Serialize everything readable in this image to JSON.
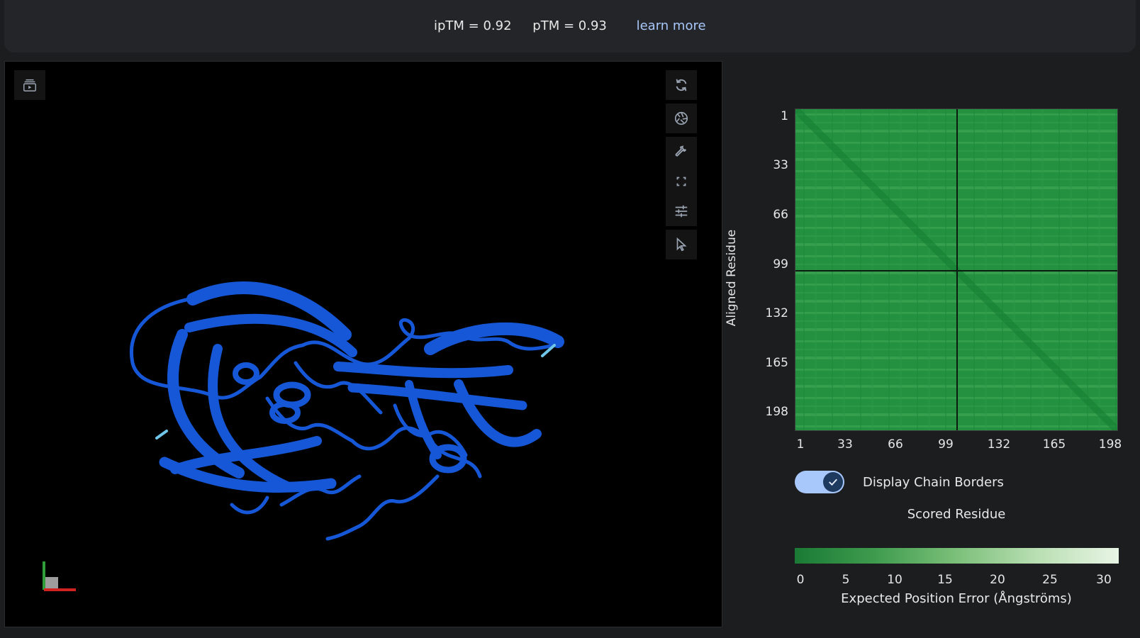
{
  "header": {
    "iptm": "ipTM = 0.92",
    "ptm": "pTM = 0.93",
    "learn_more": "learn more"
  },
  "viewer": {
    "toolbar": [
      "reset-view-icon",
      "screenshot-icon",
      "wrench-icon",
      "fullscreen-icon",
      "settings-sliders-icon",
      "selection-cursor-icon"
    ],
    "left_button": "animation-icon",
    "structure_color": "#1557d6",
    "terminal_color": "#6fc6e8"
  },
  "pae": {
    "y_axis_label": "Aligned Residue",
    "y_ticks": [
      "1",
      "33",
      "66",
      "99",
      "132",
      "165",
      "198"
    ],
    "x_ticks": [
      "1",
      "33",
      "66",
      "99",
      "132",
      "165",
      "198"
    ],
    "toggle_label": "Display Chain Borders",
    "toggle_on": true,
    "x_axis_label": "Scored Residue",
    "scale_ticks": [
      "0",
      "5",
      "10",
      "15",
      "20",
      "25",
      "30"
    ],
    "scale_title": "Expected Position Error (Ångströms)",
    "scale_min_color": "#1a7a35",
    "scale_max_color": "#e8f5e5"
  }
}
